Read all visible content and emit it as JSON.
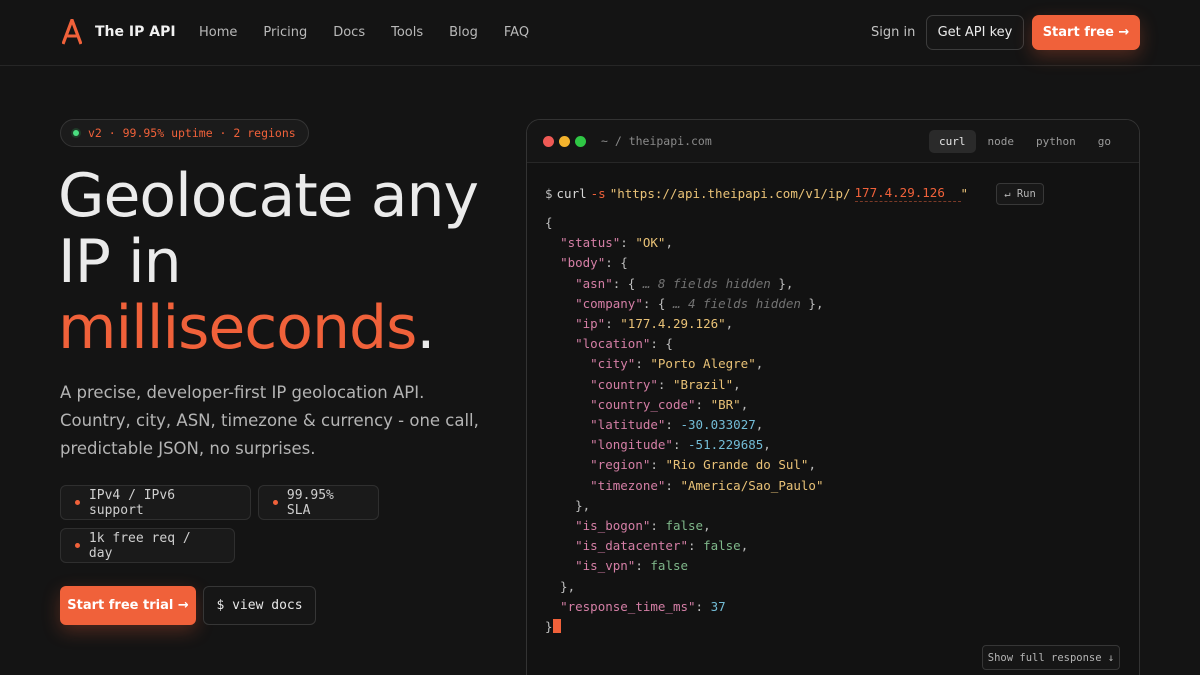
{
  "brand": {
    "name": "The IP API",
    "logo_icon": "logo-a-icon",
    "accent": "#f0613a"
  },
  "nav": {
    "links": [
      "Home",
      "Pricing",
      "Docs",
      "Tools",
      "Blog",
      "FAQ"
    ],
    "sign_in": "Sign in",
    "api_key": "Get API key",
    "start_free": "Start free →"
  },
  "hero": {
    "badge": "v2 · 99.95% uptime · 2 regions",
    "headline_1": "Geolocate any",
    "headline_2": "IP in",
    "headline_accent": "milliseconds",
    "headline_dot": ".",
    "subtext": "A precise, developer-first IP geolocation API. Country, city, ASN, timezone & currency - one call, predictable JSON, no surprises.",
    "features": [
      "IPv4 / IPv6 support",
      "99.95% SLA",
      "1k free req / day"
    ],
    "cta_primary": "Start free trial →",
    "cta_secondary": "$ view docs"
  },
  "terminal": {
    "path": "~ / theipapi.com",
    "tabs": [
      "curl",
      "node",
      "python",
      "go"
    ],
    "active_tab": "curl",
    "prompt": "$",
    "command": "curl",
    "flag": "-s",
    "url_prefix": "\"https://api.theipapi.com/v1/ip/",
    "ip_value": "177.4.29.126",
    "url_suffix": "\"",
    "run_label": "↵ Run",
    "show_full": "Show full response ↓",
    "response": {
      "status": "\"OK\"",
      "asn_hidden": "… 8 fields hidden",
      "company_hidden": "… 4 fields hidden",
      "ip": "\"177.4.29.126\"",
      "city": "\"Porto Alegre\"",
      "country": "\"Brazil\"",
      "country_code": "\"BR\"",
      "latitude": "-30.033027",
      "longitude": "-51.229685",
      "region": "\"Rio Grande do Sul\"",
      "timezone": "\"America/Sao_Paulo\"",
      "is_bogon": "false",
      "is_datacenter": "false",
      "is_vpn": "false",
      "response_time_ms": "37"
    }
  }
}
